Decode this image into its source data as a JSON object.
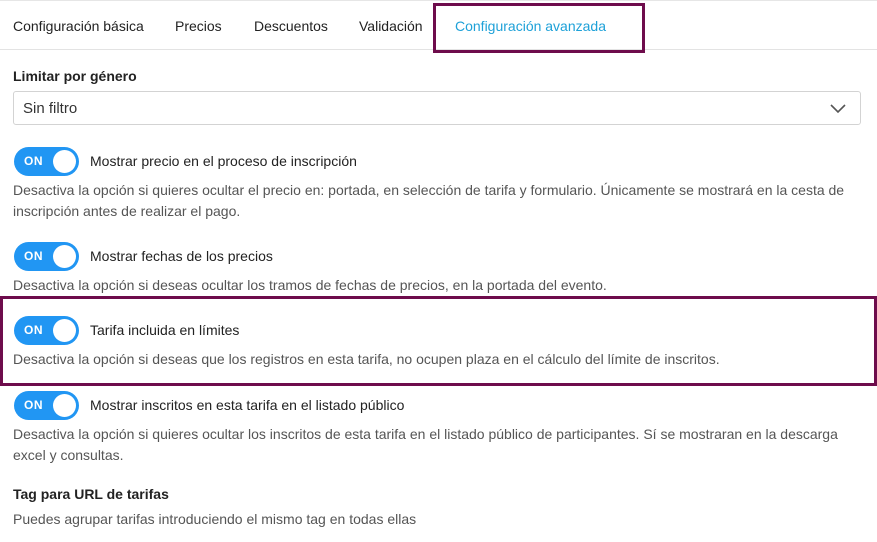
{
  "tabs": [
    {
      "label": "Configuración básica"
    },
    {
      "label": "Precios"
    },
    {
      "label": "Descuentos"
    },
    {
      "label": "Validación"
    },
    {
      "label": "Configuración avanzada",
      "active": true
    }
  ],
  "gender_filter": {
    "label": "Limitar por género",
    "selected": "Sin filtro"
  },
  "options": [
    {
      "toggle": "ON",
      "title": "Mostrar precio en el proceso de inscripción",
      "description": "Desactiva la opción si quieres ocultar el precio en: portada, en selección de tarifa y formulario. Únicamente se mostrará en la cesta de inscripción antes de realizar el pago."
    },
    {
      "toggle": "ON",
      "title": "Mostrar fechas de los precios",
      "description": "Desactiva la opción si deseas ocultar los tramos de fechas de precios, en la portada del evento."
    },
    {
      "toggle": "ON",
      "title": "Tarifa incluida en límites",
      "description": "Desactiva la opción si deseas que los registros en esta tarifa, no ocupen plaza en el cálculo del límite de inscritos."
    },
    {
      "toggle": "ON",
      "title": "Mostrar inscritos en esta tarifa en el listado público",
      "description": "Desactiva la opción si quieres ocultar los inscritos de esta tarifa en el listado público de participantes. Sí se mostraran en la descarga excel y consultas."
    }
  ],
  "tag_section": {
    "title": "Tag para URL de tarifas",
    "description": "Puedes agrupar tarifas introduciendo el mismo tag en todas ellas"
  },
  "colors": {
    "accent": "#1ea1d8",
    "toggle_on": "#2196f3",
    "highlight_border": "#6e0c4c"
  },
  "icons": {
    "select_arrow": "chevron-down-icon"
  }
}
